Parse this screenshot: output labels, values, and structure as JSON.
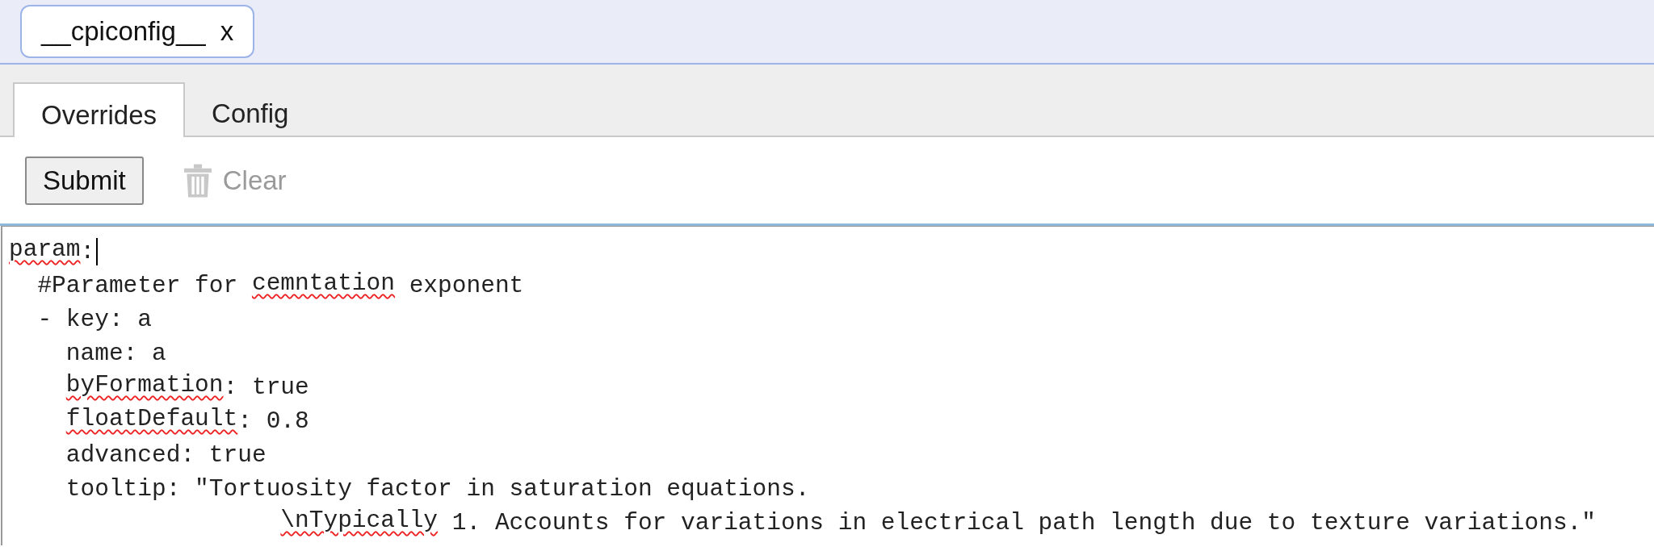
{
  "document_tabs": [
    {
      "label": "__cpiconfig__",
      "close": "x",
      "selected": true
    }
  ],
  "tabs": [
    {
      "label": "Overrides",
      "selected": true
    },
    {
      "label": "Config",
      "selected": false
    }
  ],
  "toolbar": {
    "submit": {
      "label": "Submit",
      "disabled": false
    },
    "clear": {
      "label": "Clear",
      "disabled": true
    }
  },
  "editor": {
    "lines": [
      {
        "kind": "entry",
        "cursor": true,
        "segments": [
          {
            "text": "param",
            "misspelled": true
          },
          {
            "text": ":",
            "misspelled": false
          }
        ],
        "children": [
          {
            "kind": "entry",
            "cursor": false,
            "segments": [
              {
                "text": "#Parameter for ",
                "misspelled": false
              },
              {
                "text": "cemntation",
                "misspelled": true
              },
              {
                "text": " exponent",
                "misspelled": false
              }
            ]
          },
          {
            "kind": "entry",
            "cursor": false,
            "segments": [
              {
                "text": "- key: a",
                "misspelled": false
              }
            ],
            "children": [
              {
                "kind": "entry",
                "cursor": false,
                "segments": [
                  {
                    "text": "name: a",
                    "misspelled": false
                  }
                ]
              },
              {
                "kind": "entry",
                "cursor": false,
                "segments": [
                  {
                    "text": "byFormation",
                    "misspelled": true
                  },
                  {
                    "text": ": true",
                    "misspelled": false
                  }
                ]
              },
              {
                "kind": "entry",
                "cursor": false,
                "segments": [
                  {
                    "text": "floatDefault",
                    "misspelled": true
                  },
                  {
                    "text": ": 0.8",
                    "misspelled": false
                  }
                ]
              },
              {
                "kind": "entry",
                "cursor": false,
                "segments": [
                  {
                    "text": "advanced: true",
                    "misspelled": false
                  }
                ]
              },
              {
                "kind": "entry",
                "cursor": false,
                "segments": [
                  {
                    "text": "tooltip: \"Tortuosity factor in saturation equations.",
                    "misspelled": false
                  }
                ],
                "children": [
                  {
                    "kind": "continuation",
                    "cursor": false,
                    "segments": [
                      {
                        "text": "\\nTypically",
                        "misspelled": true
                      },
                      {
                        "text": " 1. Accounts for variations in electrical path length due to texture variations.\"",
                        "misspelled": false
                      }
                    ]
                  }
                ]
              }
            ]
          }
        ]
      }
    ]
  }
}
